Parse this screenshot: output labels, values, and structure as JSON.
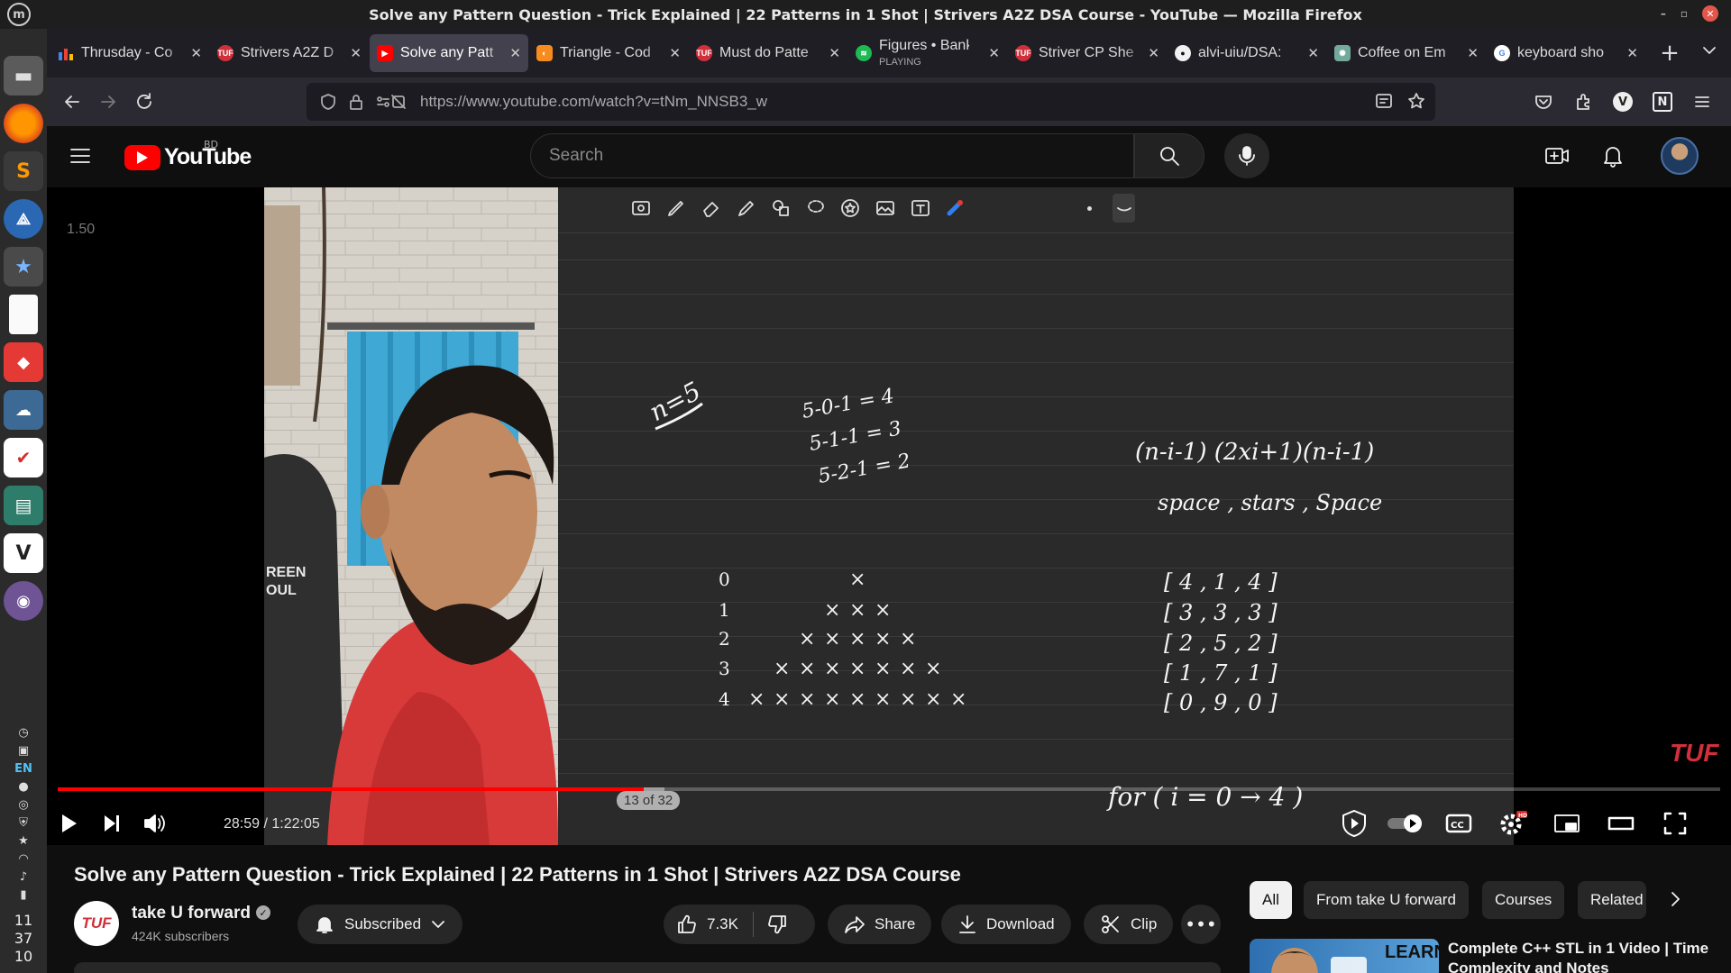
{
  "window": {
    "title": "Solve any Pattern Question - Trick Explained | 22 Patterns in 1 Shot | Strivers A2Z DSA Course - YouTube — Mozilla Firefox"
  },
  "tray": {
    "language": "EN",
    "clock": [
      "11",
      "37",
      "10"
    ]
  },
  "tabs": [
    {
      "label": "Thrusday - Co",
      "favicon": "bar-chart",
      "color": "#4285f4"
    },
    {
      "label": "Strivers A2Z D",
      "favicon": "tuf",
      "color": "#d0303a"
    },
    {
      "label": "Solve any Patt",
      "favicon": "youtube",
      "color": "#ff0000"
    },
    {
      "label": "Triangle - Cod",
      "favicon": "codingninjas",
      "color": "#f78c1e"
    },
    {
      "label": "Must do Patte",
      "favicon": "tuf",
      "color": "#d0303a"
    },
    {
      "label": "Figures • Bank",
      "sublabel": "PLAYING",
      "favicon": "spotify",
      "color": "#1db954"
    },
    {
      "label": "Striver CP She",
      "favicon": "tuf",
      "color": "#d0303a"
    },
    {
      "label": "alvi-uiu/DSA:",
      "favicon": "github",
      "color": "#f1f1f1"
    },
    {
      "label": "Coffee on Em",
      "favicon": "chatgpt",
      "color": "#74aa9c"
    },
    {
      "label": "keyboard sho",
      "favicon": "google",
      "color": "#ffffff"
    }
  ],
  "navbar": {
    "url": "https://www.youtube.com/watch?v=tNm_NNSB3_w"
  },
  "youtube": {
    "logo_text": "YouTube",
    "country": "BD",
    "search_placeholder": "Search"
  },
  "player": {
    "speed_label": "1.50",
    "watermark": "TUF",
    "progress_fraction": 0.3525,
    "buffer_fraction": 0.365,
    "chapter_tip": "13 of 32",
    "time": "28:59 / 1:22:05",
    "board": {
      "n_label": "n=5",
      "calc": [
        "5-0-1 = 4",
        "5-1-1 = 3",
        "5-2-1 = 2"
      ],
      "formula": "(n-i-1) (2xi+1)(n-i-1)",
      "formula_words": "space , stars , Space",
      "rows": [
        "0",
        "1",
        "2",
        "3",
        "4"
      ],
      "stars": [
        1,
        3,
        5,
        7,
        9
      ],
      "triples": [
        "[ 4 , 1 , 4 ]",
        "[ 3 , 3 , 3 ]",
        "[ 2 , 5 , 2 ]",
        "[ 1 , 7 , 1 ]",
        "[ 0 , 9 , 0 ]"
      ],
      "loop": "for ( i = 0 → 4 )"
    }
  },
  "video": {
    "title": "Solve any Pattern Question - Trick Explained | 22 Patterns in 1 Shot | Strivers A2Z DSA Course",
    "channel_logo": "TUF",
    "channel": "take U forward",
    "subscribers": "424K subscribers",
    "subscribed_label": "Subscribed",
    "likes": "7.3K",
    "share_label": "Share",
    "download_label": "Download",
    "clip_label": "Clip"
  },
  "chips": [
    "All",
    "From take U forward",
    "Courses",
    "Related"
  ],
  "recommended": {
    "thumb_text": "LEARN",
    "title": "Complete C++ STL in 1 Video | Time Complexity and Notes"
  }
}
